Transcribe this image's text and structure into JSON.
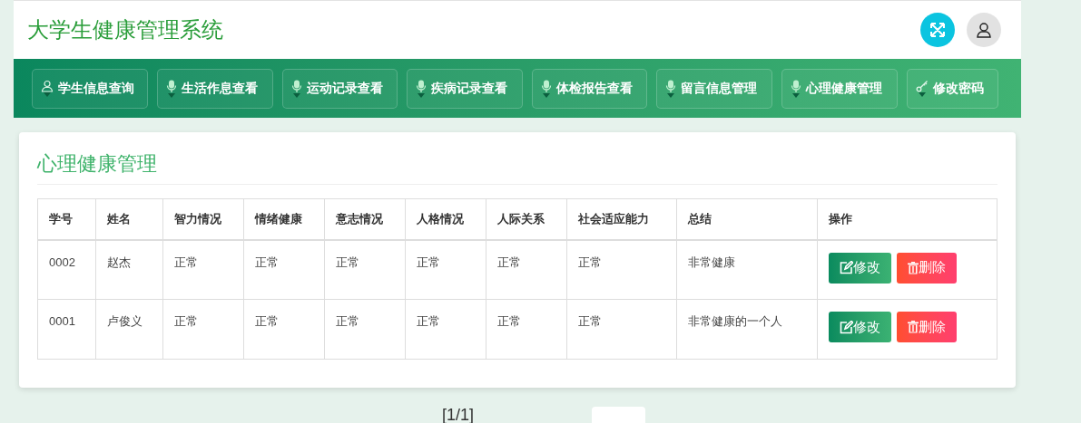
{
  "header": {
    "title": "大学生健康管理系统"
  },
  "nav": [
    {
      "kind": "user",
      "label": "学生信息查询"
    },
    {
      "kind": "mic",
      "label": "生活作息查看"
    },
    {
      "kind": "mic",
      "label": "运动记录查看"
    },
    {
      "kind": "mic",
      "label": "疾病记录查看"
    },
    {
      "kind": "mic",
      "label": "体检报告查看"
    },
    {
      "kind": "mic",
      "label": "留言信息管理"
    },
    {
      "kind": "mic",
      "label": "心理健康管理"
    },
    {
      "kind": "key",
      "label": "修改密码"
    }
  ],
  "panel": {
    "title": "心理健康管理"
  },
  "table": {
    "columns": [
      "学号",
      "姓名",
      "智力情况",
      "情绪健康",
      "意志情况",
      "人格情况",
      "人际关系",
      "社会适应能力",
      "总结",
      "操作"
    ],
    "rows": [
      {
        "cells": [
          "0002",
          "赵杰",
          "正常",
          "正常",
          "正常",
          "正常",
          "正常",
          "正常",
          "非常健康"
        ],
        "actions": [
          "修改",
          "删除"
        ]
      },
      {
        "cells": [
          "0001",
          "卢俊义",
          "正常",
          "正常",
          "正常",
          "正常",
          "正常",
          "正常",
          "非常健康的一个人"
        ],
        "actions": [
          "修改",
          "删除"
        ]
      }
    ]
  },
  "pagination": {
    "page": "[1/1]"
  }
}
